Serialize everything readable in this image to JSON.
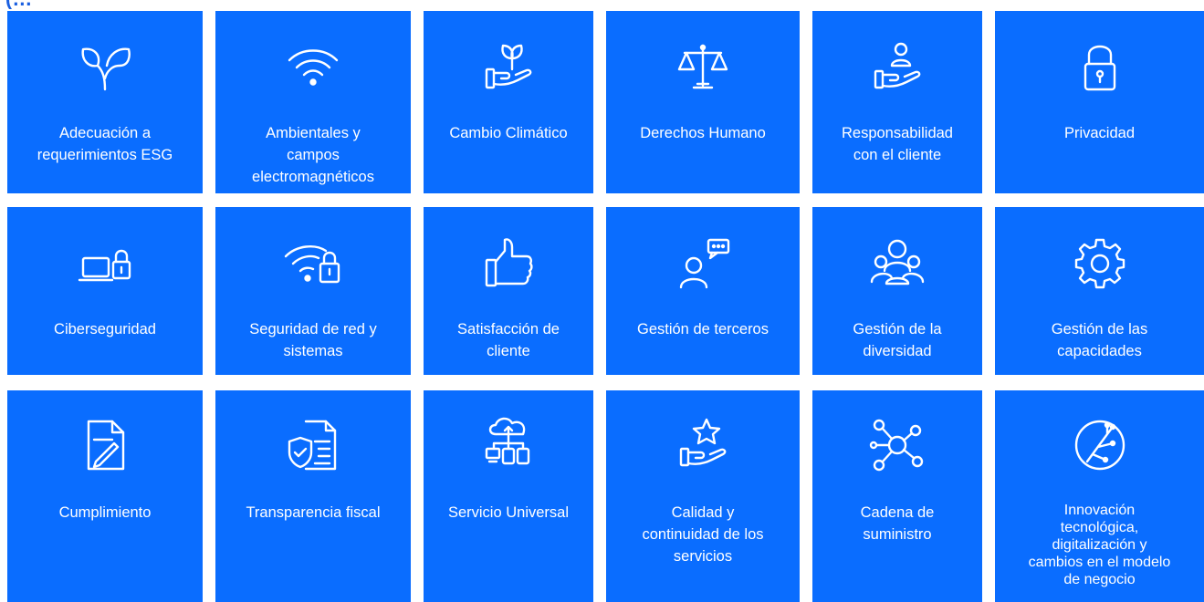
{
  "header": {
    "partial_text": "(…"
  },
  "tiles": [
    {
      "label": "Adecuación a\nrequerimientos ESG",
      "icon": "leaves-icon"
    },
    {
      "label": "Ambientales y\ncampos\nelectromagnéticos",
      "icon": "wifi-icon"
    },
    {
      "label": "Cambio Climático",
      "icon": "hand-plant-icon"
    },
    {
      "label": "Derechos Humano",
      "icon": "scales-icon"
    },
    {
      "label": "Responsabilidad\ncon el cliente",
      "icon": "hand-person-icon"
    },
    {
      "label": "Privacidad",
      "icon": "padlock-icon"
    },
    {
      "label": "Ciberseguridad",
      "icon": "laptop-lock-icon"
    },
    {
      "label": "Seguridad de red y\nsistemas",
      "icon": "wifi-lock-icon"
    },
    {
      "label": "Satisfacción de\ncliente",
      "icon": "thumbs-up-icon"
    },
    {
      "label": "Gestión de terceros",
      "icon": "person-chat-icon"
    },
    {
      "label": "Gestión de la\ndiversidad",
      "icon": "group-icon"
    },
    {
      "label": "Gestión de las\ncapacidades",
      "icon": "gear-icon"
    },
    {
      "label": "Cumplimiento",
      "icon": "document-pen-icon"
    },
    {
      "label": "Transparencia fiscal",
      "icon": "document-shield-icon"
    },
    {
      "label": "Servicio Universal",
      "icon": "cloud-network-icon"
    },
    {
      "label": "Calidad y\ncontinuidad de los\nservicios",
      "icon": "hand-star-icon"
    },
    {
      "label": "Cadena de\nsuministro",
      "icon": "network-nodes-icon"
    },
    {
      "label": "Innovación\ntecnológica,\ndigitalización y\ncambios en el modelo\nde negocio",
      "icon": "circuit-icon"
    }
  ],
  "colors": {
    "tile": "#0a6dff",
    "heading": "#1a5fe0",
    "background": "#ffffff"
  }
}
